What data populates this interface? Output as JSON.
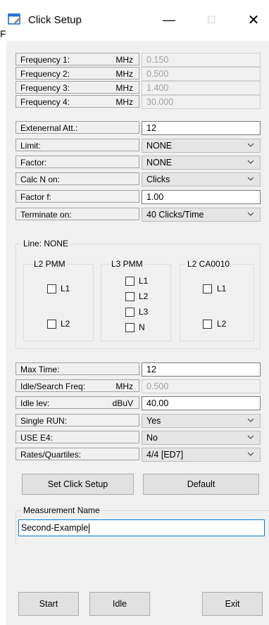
{
  "window": {
    "title": "Click Setup",
    "left_edge_glyph": "F"
  },
  "params": [
    {
      "label": "Frequency 1:",
      "unit": "MHz",
      "value": "0.150",
      "kind": "disabled"
    },
    {
      "label": "Frequency 2:",
      "unit": "MHz",
      "value": "0.500",
      "kind": "disabled"
    },
    {
      "label": "Frequency 3:",
      "unit": "MHz",
      "value": "1.400",
      "kind": "disabled"
    },
    {
      "label": "Frequency 4:",
      "unit": "MHz",
      "value": "30.000",
      "kind": "disabled"
    },
    {
      "label": "Extenernal Att.:",
      "unit": "",
      "value": "12",
      "kind": "edit"
    },
    {
      "label": "Limit:",
      "unit": "",
      "value": "NONE",
      "kind": "combo"
    },
    {
      "label": "Factor:",
      "unit": "",
      "value": "NONE",
      "kind": "combo"
    },
    {
      "label": "Calc N on:",
      "unit": "",
      "value": "Clicks",
      "kind": "combo"
    },
    {
      "label": "Factor f:",
      "unit": "",
      "value": "1.00",
      "kind": "edit"
    },
    {
      "label": "Terminate on:",
      "unit": "",
      "value": "40 Clicks/Time",
      "kind": "combo"
    }
  ],
  "line_group": {
    "title": "Line: NONE",
    "l2pmm": {
      "title": "L2 PMM",
      "items": [
        "L1",
        "L2"
      ]
    },
    "l3pmm": {
      "title": "L3 PMM",
      "items": [
        "L1",
        "L2",
        "L3",
        "N"
      ]
    },
    "l2ca": {
      "title": "L2 CA0010",
      "items": [
        "L1",
        "L2"
      ]
    }
  },
  "params2": [
    {
      "label": "Max Time:",
      "unit": "",
      "value": "12",
      "kind": "edit"
    },
    {
      "label": "Idle/Search Freq:",
      "unit": "MHz",
      "value": "0.500",
      "kind": "disabled"
    },
    {
      "label": "Idle lev:",
      "unit": "dBuV",
      "value": "40.00",
      "kind": "edit"
    },
    {
      "label": "Single RUN:",
      "unit": "",
      "value": "Yes",
      "kind": "combo"
    },
    {
      "label": "USE E4:",
      "unit": "",
      "value": "No",
      "kind": "combo"
    },
    {
      "label": "Rates/Quartiles:",
      "unit": "",
      "value": "4/4 [ED7]",
      "kind": "combo"
    }
  ],
  "buttons": {
    "set_click_setup": "Set Click Setup",
    "default": "Default",
    "start": "Start",
    "idle": "Idle",
    "exit": "Exit"
  },
  "measurement": {
    "legend": "Measurement Name",
    "value": "Second-Example"
  },
  "icons": {
    "app": "window-settings-icon",
    "chevron": "chevron-down-icon"
  }
}
